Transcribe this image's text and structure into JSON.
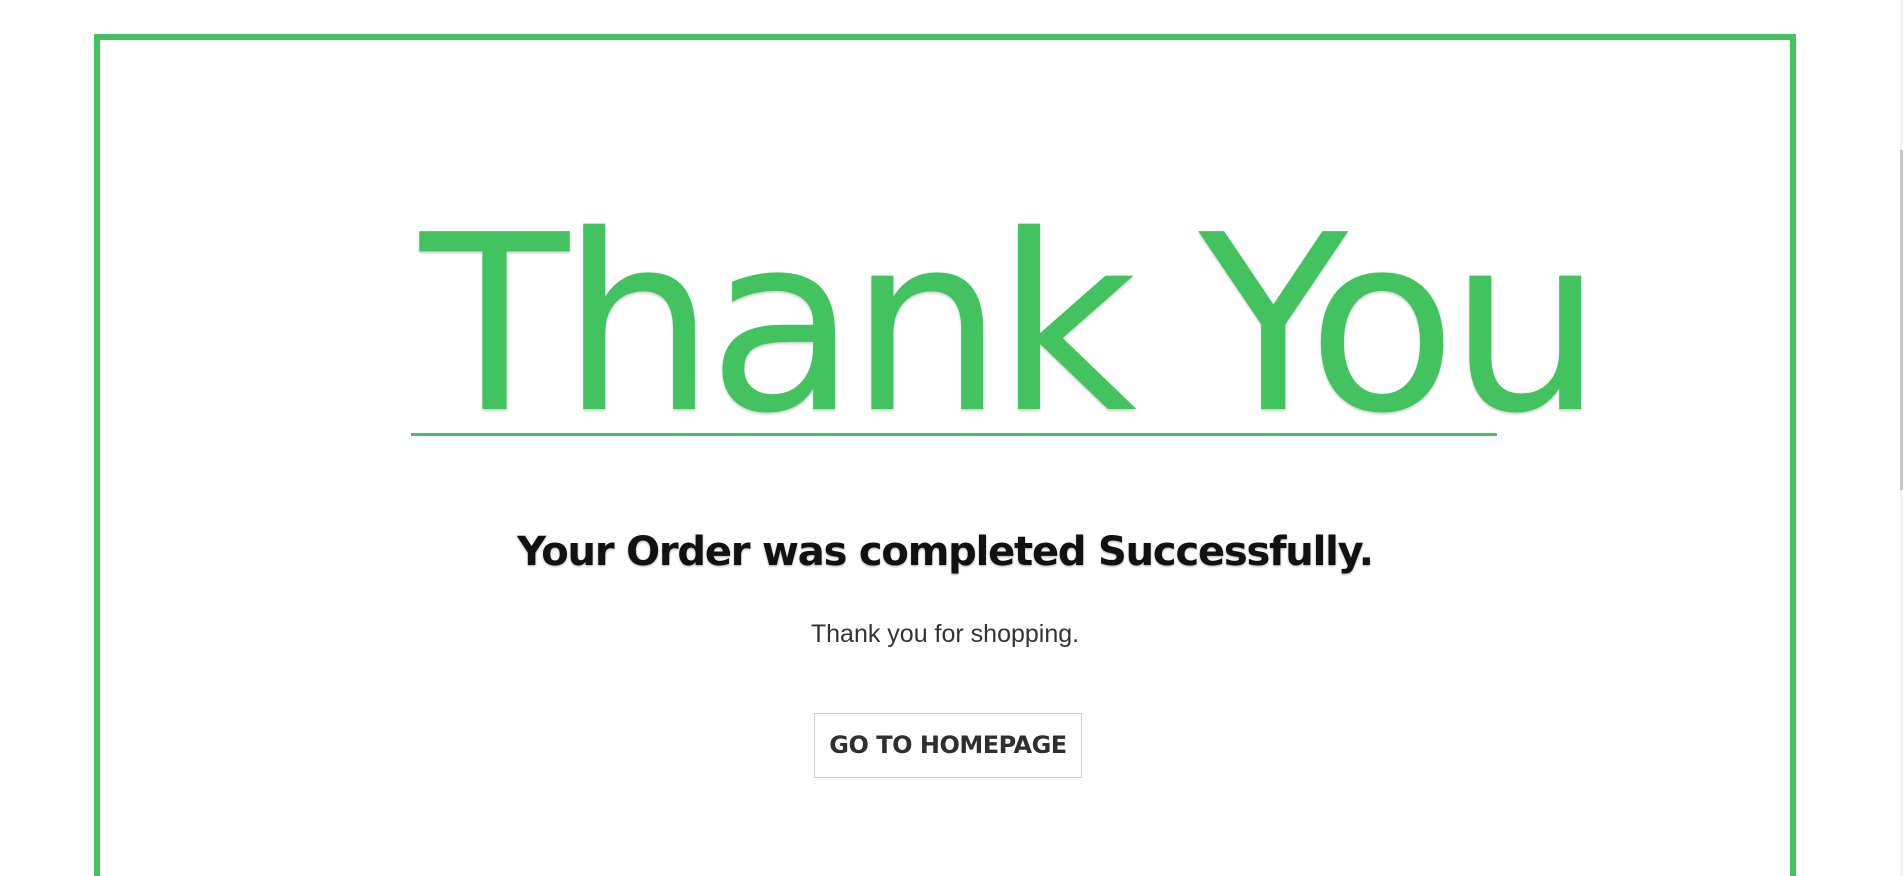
{
  "thank_you": {
    "title": "Thank You",
    "subtitle": "Your Order was completed Successfully.",
    "message": "Thank you for shopping.",
    "button_label": "GO TO HOMEPAGE"
  },
  "colors": {
    "accent": "#42c35f",
    "text": "#111111",
    "muted_text": "#333333",
    "border": "#cfcfcf"
  }
}
